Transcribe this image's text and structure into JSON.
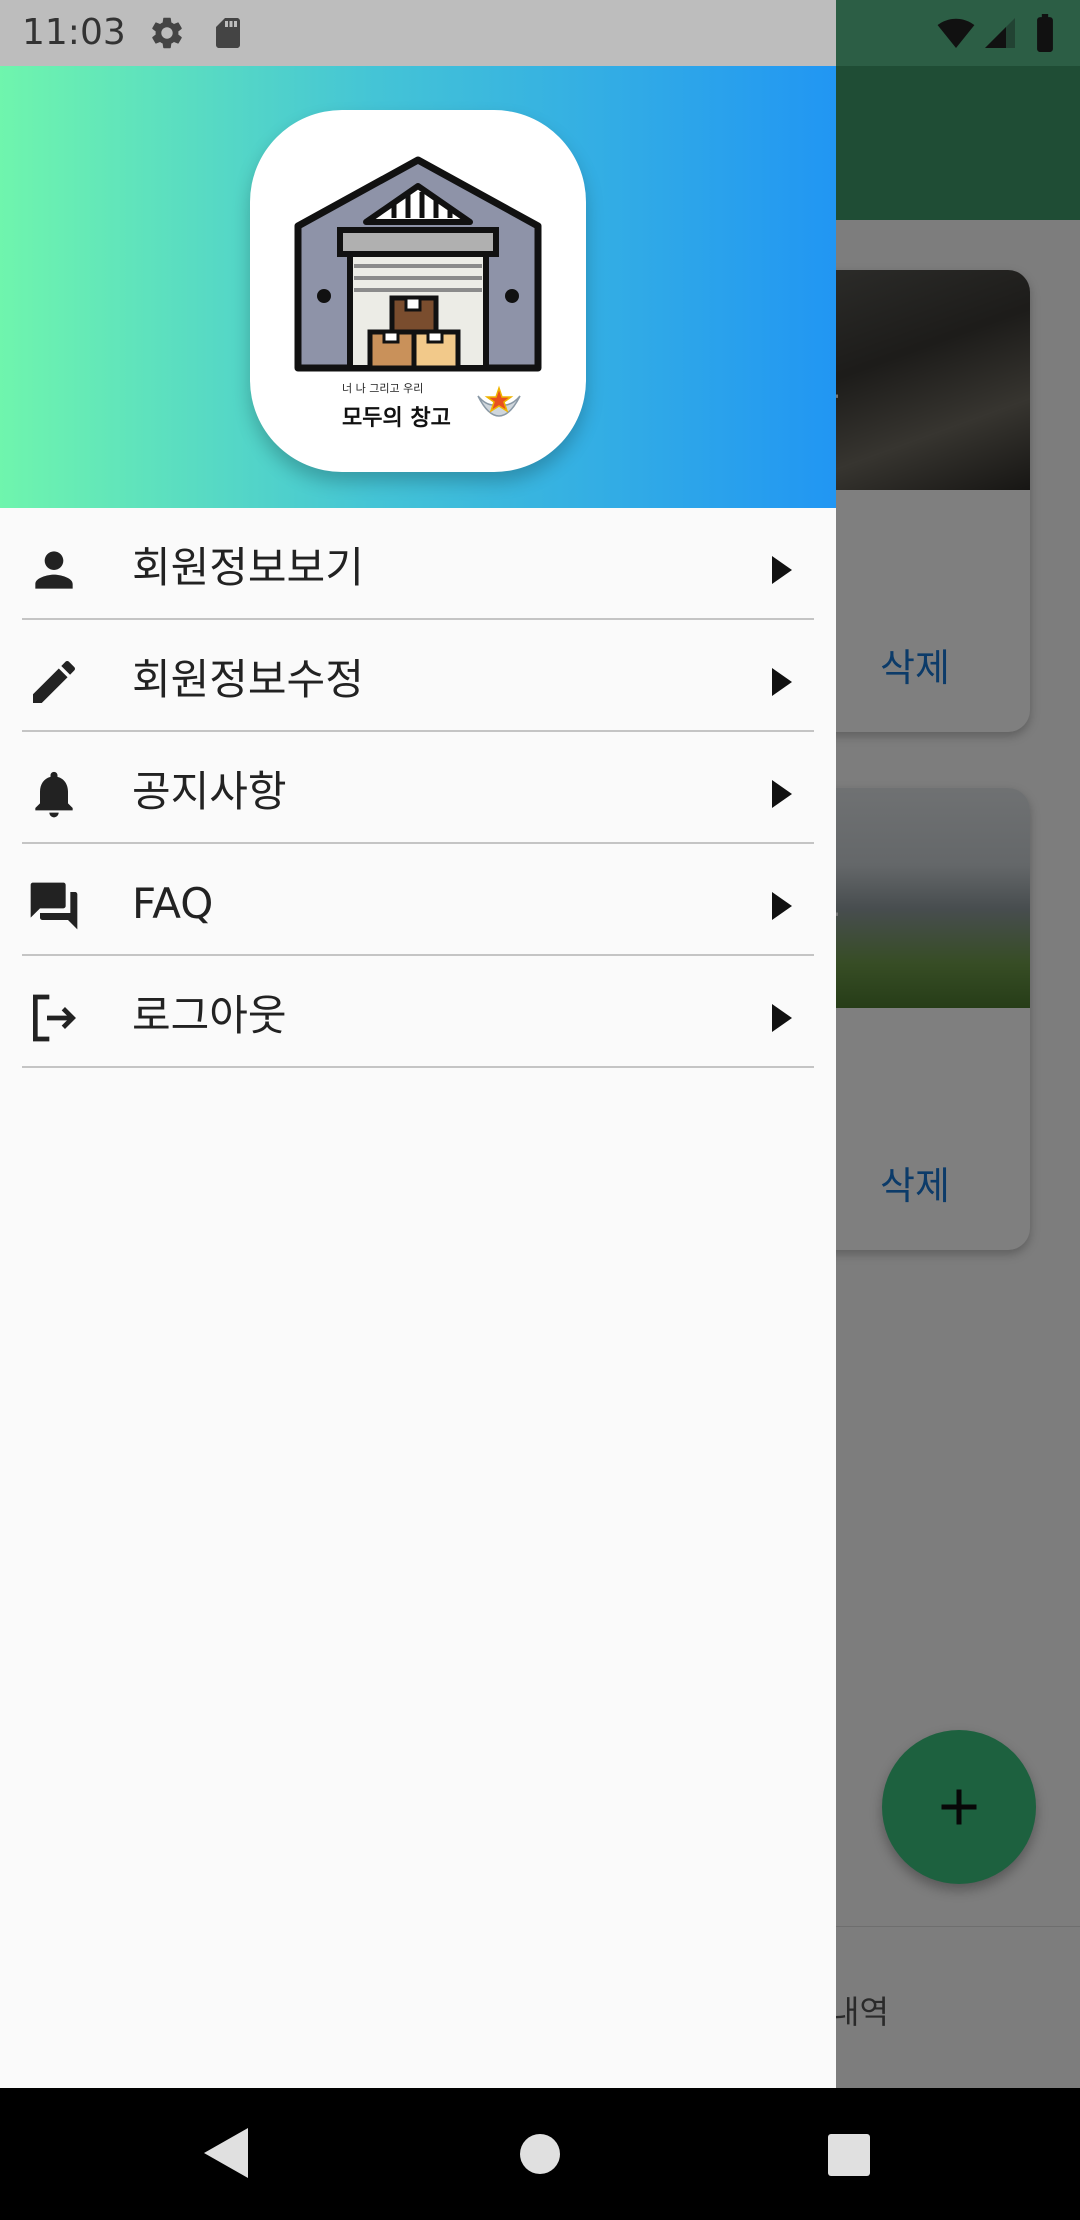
{
  "status_bar": {
    "time": "11:03",
    "icons_left": [
      "settings-icon",
      "sd-card-icon"
    ],
    "icons_right": [
      "wifi-icon",
      "signal-icon",
      "battery-icon"
    ]
  },
  "drawer": {
    "logo": {
      "small_text": "너 나 그리고 우리",
      "title": "모두의 창고"
    },
    "menu_items": [
      {
        "label": "회원정보보기",
        "icon": "person-icon"
      },
      {
        "label": "회원정보수정",
        "icon": "edit-pencil-icon"
      },
      {
        "label": "공지사항",
        "icon": "bell-icon"
      },
      {
        "label": "FAQ",
        "icon": "forum-icon"
      },
      {
        "label": "로그아웃",
        "icon": "logout-icon"
      }
    ]
  },
  "background": {
    "cards": [
      {
        "image_text": "고",
        "delete_label": "삭제"
      },
      {
        "image_text": "고",
        "delete_label": "삭제"
      }
    ],
    "fab_icon": "add-icon",
    "bottom_nav_label": "내역"
  },
  "nav_bar": {
    "buttons": [
      "back-icon",
      "home-icon",
      "recents-icon"
    ]
  },
  "colors": {
    "header_gradient_start": "#6ff5ad",
    "header_gradient_end": "#2196f3",
    "app_bar": "#3e9a6b",
    "fab": "#3bc27f",
    "link_blue": "#1976d2"
  }
}
